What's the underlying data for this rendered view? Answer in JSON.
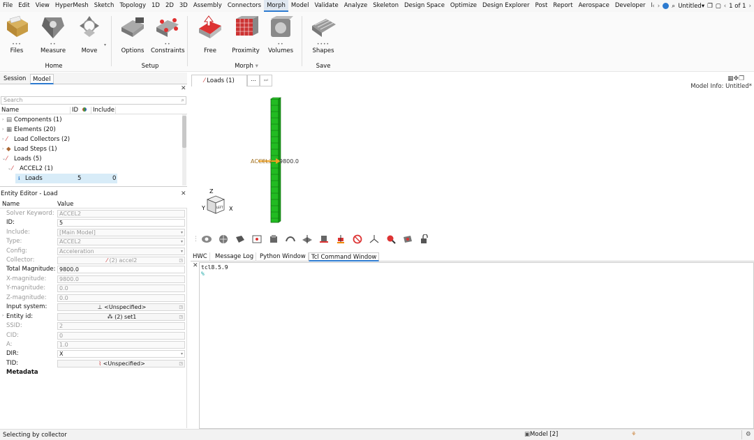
{
  "menubar": {
    "items": [
      "File",
      "Edit",
      "View",
      "HyperMesh",
      "Sketch",
      "Topology",
      "1D",
      "2D",
      "3D",
      "Assembly",
      "Connectors",
      "Morph",
      "Model",
      "Validate",
      "Analyze",
      "Skeleton",
      "Design Space",
      "Optimize",
      "Design Explorer",
      "Post",
      "Report",
      "Aerospace",
      "Developer",
      "Pl"
    ],
    "active": "Morph",
    "doc_title": "Untitled",
    "page": "1 of 1"
  },
  "ribbon": {
    "files": "Files",
    "measure": "Measure",
    "move": "Move",
    "options": "Options",
    "constraints": "Constraints",
    "free": "Free",
    "proximity": "Proximity",
    "volumes": "Volumes",
    "shapes": "Shapes",
    "group_home": "Home",
    "group_setup": "Setup",
    "group_morph": "Morph",
    "group_save": "Save"
  },
  "left_tabs": {
    "session": "Session",
    "model": "Model"
  },
  "browser": {
    "search_placeholder": "Search",
    "col_name": "Name",
    "col_id": "ID",
    "col_include": "Include",
    "rows": [
      {
        "label": "Components (1)"
      },
      {
        "label": "Elements (20)"
      },
      {
        "label": "Load Collectors (2)"
      },
      {
        "label": "Load Steps (1)"
      },
      {
        "label": "Loads (5)"
      },
      {
        "label": "ACCEL2 (1)"
      },
      {
        "label": "Loads",
        "id": "5",
        "include": "0"
      }
    ]
  },
  "entity_editor": {
    "title": "Entity Editor - Load",
    "col_name": "Name",
    "col_value": "Value",
    "props": [
      {
        "label": "Solver Keyword:",
        "value": "ACCEL2"
      },
      {
        "label": "ID:",
        "value": "5"
      },
      {
        "label": "Include:",
        "value": "[Main Model]"
      },
      {
        "label": "Type:",
        "value": "ACCEL2"
      },
      {
        "label": "Config:",
        "value": "Acceleration"
      },
      {
        "label": "Collector:",
        "value": "(2) accel2"
      },
      {
        "label": "Total Magnitude:",
        "value": "9800.0"
      },
      {
        "label": "X-magnitude:",
        "value": "9800.0"
      },
      {
        "label": "Y-magnitude:",
        "value": "0.0"
      },
      {
        "label": "Z-magnitude:",
        "value": "0.0"
      },
      {
        "label": "Input system:",
        "value": "<Unspecified>"
      },
      {
        "label": "Entity id:",
        "value": "(2) set1"
      },
      {
        "label": "SSID:",
        "value": "2"
      },
      {
        "label": "CID:",
        "value": "0"
      },
      {
        "label": "A:",
        "value": "1.0"
      },
      {
        "label": "DIR:",
        "value": "X"
      },
      {
        "label": "TID:",
        "value": "<Unspecified>"
      }
    ],
    "metadata": "Metadata"
  },
  "graphics": {
    "loads_tab": "Loads (1)",
    "model_info": "Model Info: Untitled*",
    "load_label": "ACCEL2",
    "load_value": "9800.0",
    "triad": {
      "z": "Z",
      "y": "Y",
      "x": "X",
      "cube": "LEFT"
    }
  },
  "bottom_tabs": [
    "HWC",
    "Message Log",
    "Python Window",
    "Tcl Command Window"
  ],
  "console": {
    "line1": "tcl8.5.9",
    "prompt": "%"
  },
  "status": {
    "left": "Selecting by collector",
    "model": "Model [2]"
  },
  "colors": {
    "accent": "#2d7bd0",
    "beam": "#22bb22",
    "arrow": "#f0a020"
  }
}
